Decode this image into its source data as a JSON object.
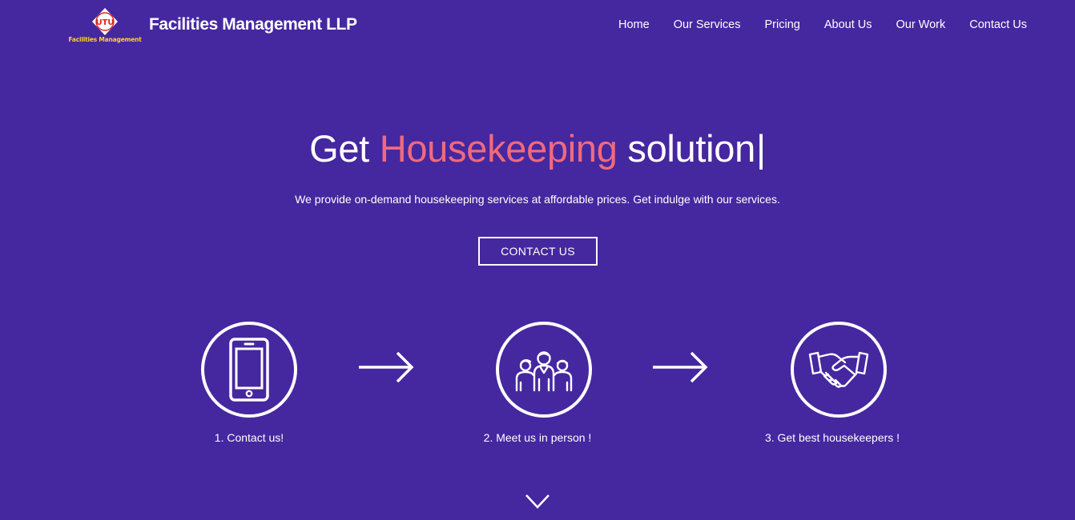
{
  "header": {
    "logo_initials": "UTU",
    "logo_caption": "Facilities Management",
    "brand_name": "Facilities Management LLP"
  },
  "nav": [
    {
      "label": "Home"
    },
    {
      "label": "Our Services"
    },
    {
      "label": "Pricing"
    },
    {
      "label": "About Us"
    },
    {
      "label": "Our Work"
    },
    {
      "label": "Contact Us"
    }
  ],
  "hero": {
    "title_prefix": "Get",
    "title_highlight": "Housekeeping",
    "title_suffix": "solution",
    "cursor": "|",
    "subtitle": "We provide on-demand housekeeping services at affordable prices. Get indulge with our services.",
    "cta_label": "CONTACT US"
  },
  "steps": [
    {
      "label": "1. Contact us!",
      "icon": "smartphone-icon"
    },
    {
      "label": "2. Meet us in person !",
      "icon": "group-people-icon"
    },
    {
      "label": "3. Get best housekeepers !",
      "icon": "handshake-icon"
    }
  ],
  "colors": {
    "background": "#4527a0",
    "accent": "#f06a7d",
    "logo_caption": "#ffd21f",
    "logo_red": "#e0261f"
  }
}
